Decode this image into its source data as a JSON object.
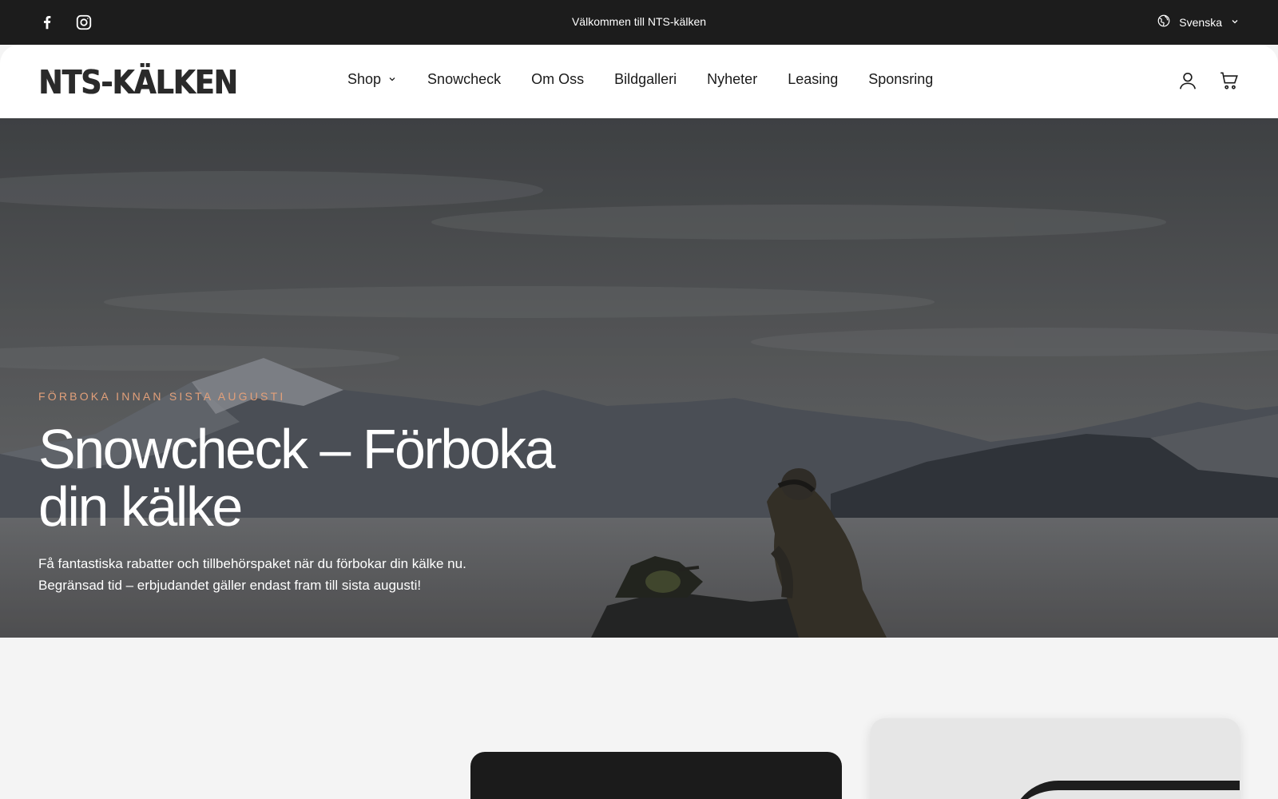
{
  "announcement": {
    "message": "Välkommen till NTS-kälken",
    "language": "Svenska",
    "social_icons": [
      "facebook-icon",
      "instagram-icon"
    ]
  },
  "header": {
    "logo_text": "NTS-KÄLKEN",
    "nav": [
      {
        "label": "Shop",
        "has_dropdown": true
      },
      {
        "label": "Snowcheck"
      },
      {
        "label": "Om Oss"
      },
      {
        "label": "Bildgalleri"
      },
      {
        "label": "Nyheter"
      },
      {
        "label": "Leasing"
      },
      {
        "label": "Sponsring"
      }
    ],
    "icons": [
      "account-icon",
      "cart-icon"
    ]
  },
  "hero": {
    "eyebrow": "FÖRBOKA INNAN SISTA AUGUSTI",
    "title": "Snowcheck – Förboka din kälke",
    "text_line1": "Få fantastiska rabatter och tillbehörspaket när du förbokar din kälke nu.",
    "text_line2": "Begränsad tid – erbjudandet gäller endast fram till sista augusti!"
  },
  "colors": {
    "announcement_bg": "#1c1c1c",
    "eyebrow": "#e2a07a",
    "page_bg": "#f4f4f4"
  }
}
